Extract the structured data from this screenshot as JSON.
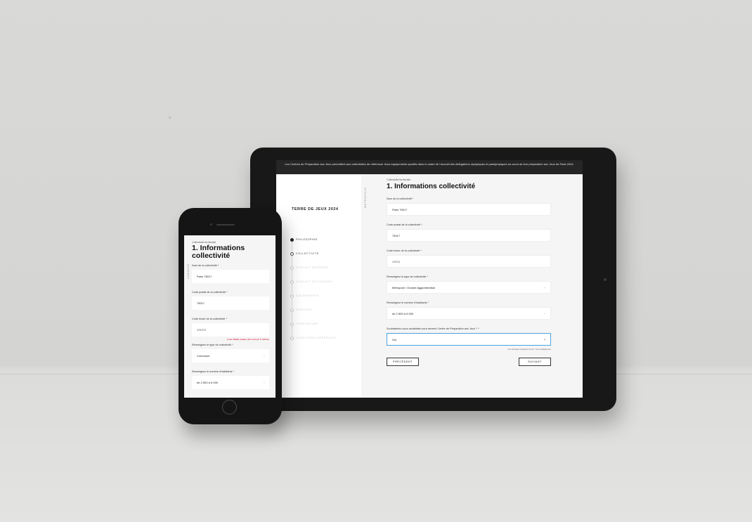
{
  "tablet": {
    "banner": "Les Centres de Préparation aux Jeux permettent aux collectivités de référencer leurs équipements sportifs dans le cadre de l’accueil des délégations olympiques et paralympiques au cours de leur préparation aux Jeux de Paris 2024.",
    "brand": "TERRE DE JEUX 2024",
    "vertical_label": "MÉTROPOLE",
    "steps": [
      "PHILOSOPHIE",
      "COLLECTIVITÉ",
      "CONTACT RÉFÉRENT",
      "CONTACT SECONDAIRE",
      "ÉQUIPEMENTS",
      "SERVICES",
      "CANDIDATURE",
      "CONDITIONS GÉNÉRALES"
    ],
    "section_kicker": "Collectivité territoriale",
    "section_title": "1. Informations collectivité",
    "fields": [
      {
        "label": "Nom de la collectivité *",
        "value": "Paris 75017"
      },
      {
        "label": "Code postal de la collectivité *",
        "value": "75017"
      },
      {
        "label": "Code Insee de la collectivité *",
        "value": "17171"
      },
      {
        "label": "Renseignez le type de collectivité *",
        "value": "Métropole / Grande Agglomération"
      },
      {
        "label": "Renseignez le nombre d’habitants *",
        "value": "de 2.500 à 5.000"
      },
      {
        "label": "Souhaiteriez-vous candidater pour devenir Centre de Préparation aux Jeux ? *",
        "value": "Oui"
      }
    ],
    "required_note": "Les champs marqués d’une * sont obligatoires",
    "prev_button": "PRÉCÉDENT",
    "next_button": "SUIVANT"
  },
  "phone": {
    "vertical_label": "COMMUNE",
    "section_kicker": "Collectivité territoriale",
    "section_title": "1. Informations collectivité",
    "fields": [
      {
        "label": "Nom de la collectivité *",
        "value": "Paris 75017"
      },
      {
        "label": "Code postal de la collectivité *",
        "value": "75017"
      },
      {
        "label": "Code Insee de la collectivité *",
        "value": "171717"
      },
      {
        "label": "Renseignez le type de collectivité *",
        "value": "Commune"
      },
      {
        "label": "Renseignez le nombre d’habitants *",
        "value": "de 2.500 à 5.000"
      }
    ],
    "insee_error": "Code INSEE invalide (doit contenir 5 chiffres)"
  },
  "colors": {
    "accent": "#4aa3df",
    "error": "#d0021b",
    "device": "#181818"
  },
  "icons": {
    "select": "chevron-down-icon"
  }
}
